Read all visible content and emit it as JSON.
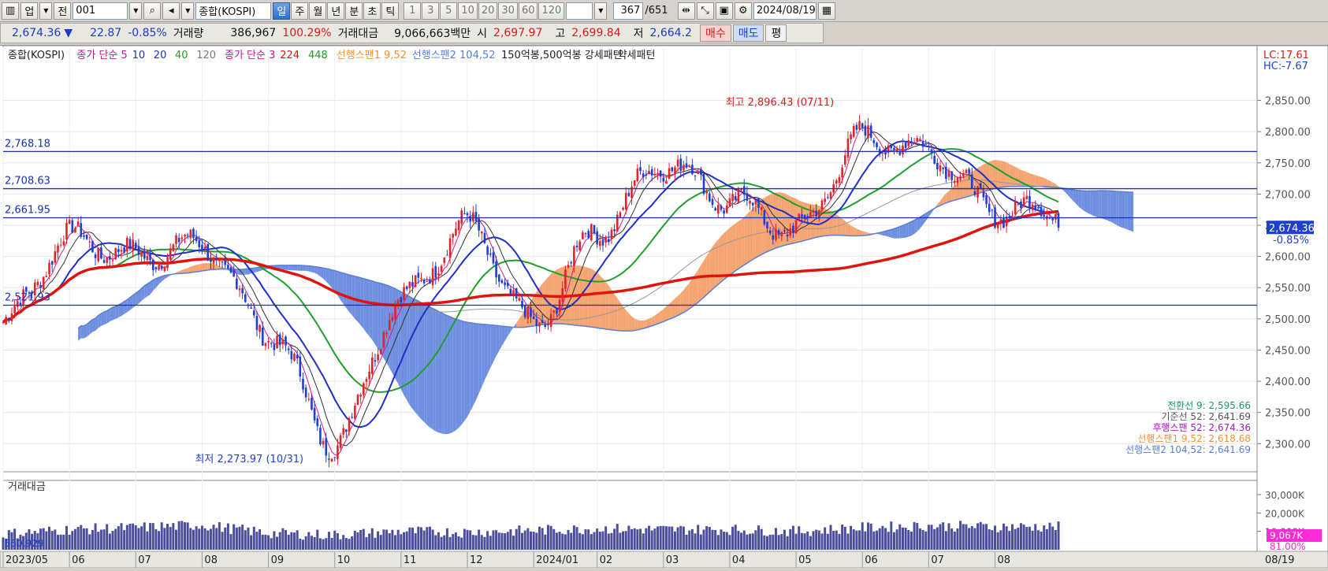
{
  "toolbar": {
    "market_label": "업",
    "period_label": "전",
    "code": "001",
    "name": "종합(KOSPI)",
    "period_buttons": [
      "일",
      "주",
      "월",
      "년",
      "분",
      "초",
      "틱"
    ],
    "active_period": "일",
    "interval_buttons": [
      "1",
      "3",
      "5",
      "10",
      "20",
      "30",
      "60",
      "120"
    ],
    "count": "367",
    "total": "/651",
    "date": "2024/08/19"
  },
  "quote": {
    "price": "2,674.36",
    "arrow": "▼",
    "change": "22.87",
    "change_pct": "-0.85%",
    "volume_label": "거래량",
    "volume": "386,967",
    "volume_pct": "100.29%",
    "amount_label": "거래대금",
    "amount": "9,066,663백만",
    "open_label": "시",
    "open": "2,697.97",
    "high_label": "고",
    "high": "2,699.84",
    "low_label": "저",
    "low": "2,664.2",
    "buy_label": "매수",
    "sell_label": "매도",
    "flat_label": "평"
  },
  "legend": {
    "name": "종합(KOSPI)",
    "ma_label": "종가 단순 5",
    "ma_10": "10",
    "ma_20": "20",
    "ma_40": "40",
    "ma_120": "120",
    "ma2_label": "종가 단순 3",
    "ma2_224": "224",
    "ma2_448": "448",
    "span1": "선행스팬1 9,52",
    "span2": "선행스팬2 104,52",
    "pattern": "150억봉,500억봉 강세패턴",
    "weak": "약세패턴"
  },
  "corner": {
    "lc": "LC:17.61",
    "hc": "HC:-7.67"
  },
  "chart_data": [
    {
      "type": "line",
      "subtype": "candlestick_ichimoku",
      "title": "종합(KOSPI)",
      "ylim": [
        2260,
        2910
      ],
      "y_ticks": [
        "2,850.00",
        "2,800.00",
        "2,750.00",
        "2,700.00",
        "2,650.00",
        "2,600.00",
        "2,550.00",
        "2,500.00",
        "2,450.00",
        "2,400.00",
        "2,350.00",
        "2,300.00"
      ],
      "x_ticks": [
        "2023/05",
        "06",
        "07",
        "08",
        "09",
        "10",
        "11",
        "12",
        "2024/01",
        "02",
        "03",
        "04",
        "05",
        "06",
        "07",
        "08"
      ],
      "x_end_label": "08/19",
      "horizontal_lines": [
        {
          "label": "2,768.18",
          "value": 2768.18
        },
        {
          "label": "2,708.63",
          "value": 2708.63
        },
        {
          "label": "2,661.95",
          "value": 2661.95
        },
        {
          "label": "2,521.93",
          "value": 2521.93
        }
      ],
      "current_price_label": "2,674.36",
      "current_pct_label": "-0.85%",
      "high_annotation": "최고 2,896.43 (07/11)",
      "low_annotation": "최저 2,273.97 (10/31)",
      "monthly_close": [
        {
          "x": "2023/05",
          "value": 2495
        },
        {
          "x": "06",
          "value": 2630
        },
        {
          "x": "07",
          "value": 2600
        },
        {
          "x": "08",
          "value": 2620
        },
        {
          "x": "09",
          "value": 2480
        },
        {
          "x": "10",
          "value": 2300
        },
        {
          "x": "11",
          "value": 2530
        },
        {
          "x": "12",
          "value": 2650
        },
        {
          "x": "2024/01",
          "value": 2490
        },
        {
          "x": "02",
          "value": 2640
        },
        {
          "x": "03",
          "value": 2750
        },
        {
          "x": "04",
          "value": 2690
        },
        {
          "x": "05",
          "value": 2640
        },
        {
          "x": "06",
          "value": 2790
        },
        {
          "x": "07",
          "value": 2770
        },
        {
          "x": "08",
          "value": 2674
        }
      ],
      "ichimoku_values": [
        {
          "label": "전환선 9: 2,595.66",
          "color": "#1a9a5a"
        },
        {
          "label": "기준선 52: 2,641.69",
          "color": "#555555"
        },
        {
          "label": "후행스팬 52: 2,674.36",
          "color": "#a020c0"
        },
        {
          "label": "선행스팬1 9,52: 2,618.68",
          "color": "#f0903a"
        },
        {
          "label": "선행스팬2 104,52: 2,641.69",
          "color": "#5a7fd6"
        }
      ]
    },
    {
      "type": "bar",
      "title": "거래대금",
      "y_ticks": [
        "30,000K",
        "20,000K",
        "10,000K"
      ],
      "bottom_left_label": "550,929",
      "current_value_label": "9,067K",
      "current_pct_label": "81.00%",
      "monthly_avg": [
        {
          "x": "2023/05",
          "value": 8500
        },
        {
          "x": "06",
          "value": 11000
        },
        {
          "x": "07",
          "value": 12000
        },
        {
          "x": "08",
          "value": 13500
        },
        {
          "x": "09",
          "value": 9000
        },
        {
          "x": "10",
          "value": 8000
        },
        {
          "x": "11",
          "value": 10000
        },
        {
          "x": "12",
          "value": 9500
        },
        {
          "x": "2024/01",
          "value": 10500
        },
        {
          "x": "02",
          "value": 11500
        },
        {
          "x": "03",
          "value": 11000
        },
        {
          "x": "04",
          "value": 11000
        },
        {
          "x": "05",
          "value": 10000
        },
        {
          "x": "06",
          "value": 12000
        },
        {
          "x": "07",
          "value": 13000
        },
        {
          "x": "08",
          "value": 12500
        }
      ]
    }
  ],
  "colors": {
    "up": "#e2232a",
    "down": "#1f3fd1",
    "cloud_up": "#f4a571",
    "cloud_down": "#6f8fe0",
    "ma_long": "#e0140c",
    "ma_blue": "#1f2fc8",
    "ma_green": "#1fa02a"
  }
}
